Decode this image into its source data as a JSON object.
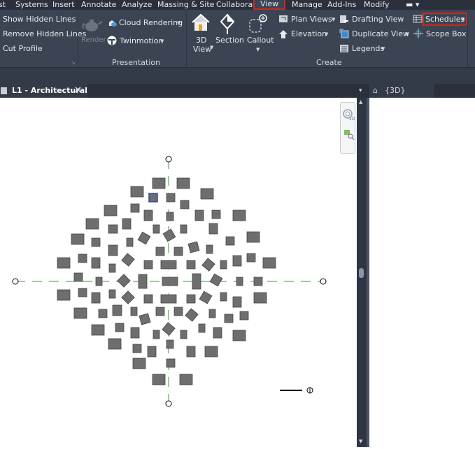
{
  "menubar": {
    "items": [
      "st",
      "Systems",
      "Insert",
      "Annotate",
      "Analyze",
      "Massing & Site",
      "Collaborate",
      "View",
      "Manage",
      "Add-Ins",
      "Modify"
    ],
    "active": "View"
  },
  "ribbon": {
    "graphics": {
      "show_hidden": "Show  Hidden Lines",
      "remove_hidden": "Remove  Hidden Lines",
      "cut_profile": "Cut  Profile"
    },
    "presentation": {
      "render": "Render",
      "cloud_rendering": "Cloud  Rendering",
      "twinmotion": "Twinmotion",
      "label": "Presentation"
    },
    "create": {
      "view3d_line1": "3D",
      "view3d_line2": "View",
      "section": "Section",
      "callout": "Callout",
      "plan_views": "Plan  Views",
      "elevation": "Elevation",
      "drafting_view": "Drafting  View",
      "duplicate_view": "Duplicate  View",
      "legends": "Legends",
      "schedules": "Schedules",
      "scope_box": "Scope  Box",
      "label": "Create"
    }
  },
  "tabs": {
    "active": "L1 - Architectural",
    "other": "{3D}"
  },
  "colors": {
    "ribbon": "#3b4453",
    "highlight": "#c62b22",
    "grid_line": "#3a9a3a",
    "element_fill": "#6e6e6e",
    "selected_outline": "#2c4a9a"
  },
  "highlight_color": "#c62b22"
}
